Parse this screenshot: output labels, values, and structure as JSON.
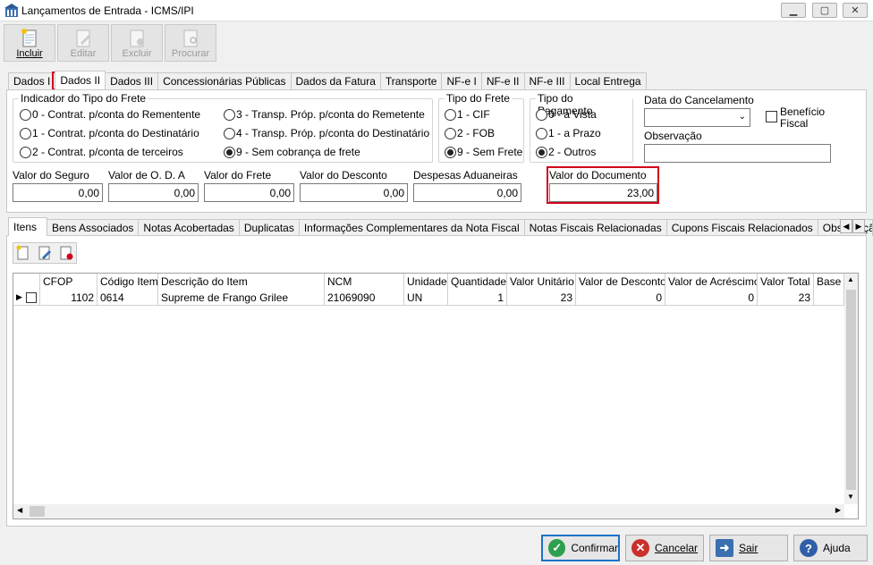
{
  "window": {
    "title": "Lançamentos de Entrada - ICMS/IPI"
  },
  "toolbar": {
    "incluir": "Incluir",
    "editar": "Editar",
    "excluir": "Excluir",
    "procurar": "Procurar"
  },
  "tabs": [
    "Dados I",
    "Dados II",
    "Dados III",
    "Concessionárias Públicas",
    "Dados da Fatura",
    "Transporte",
    "NF-e I",
    "NF-e II",
    "NF-e III",
    "Local Entrega"
  ],
  "frete": {
    "label": "Indicador do Tipo do Frete",
    "options": [
      "0 - Contrat. p/conta do Rementente",
      "1 - Contrat. p/conta do Destinatário",
      "2 - Contrat. p/conta de terceiros",
      "3 - Transp. Próp. p/conta do Remetente",
      "4 - Transp. Próp. p/conta do Destinatário",
      "9 - Sem cobrança de frete"
    ]
  },
  "tipo_frete": {
    "label": "Tipo do Frete",
    "options": [
      "1 - CIF",
      "2 - FOB",
      "9 - Sem Frete"
    ]
  },
  "tipo_pagamento": {
    "label": "Tipo do Pagamento",
    "options": [
      "0 - à Vista",
      "1 - a Prazo",
      "2 - Outros"
    ]
  },
  "cancel": {
    "label": "Data do Cancelamento",
    "value": ""
  },
  "beneficio": {
    "label1": "Benefício",
    "label2": "Fiscal"
  },
  "observacao": {
    "label": "Observação",
    "value": ""
  },
  "valores": {
    "seguro": {
      "label": "Valor do Seguro",
      "value": "0,00"
    },
    "oda": {
      "label": "Valor de O. D. A",
      "value": "0,00"
    },
    "frete": {
      "label": "Valor do Frete",
      "value": "0,00"
    },
    "desconto": {
      "label": "Valor do Desconto",
      "value": "0,00"
    },
    "aduaneiras": {
      "label": "Despesas Aduaneiras",
      "value": "0,00"
    },
    "documento": {
      "label": "Valor do Documento",
      "value": "23,00"
    }
  },
  "lower_tabs": [
    "Itens",
    "Bens Associados",
    "Notas Acobertadas",
    "Duplicatas",
    "Informações Complementares da Nota Fiscal",
    "Notas Fiscais Relacionadas",
    "Cupons Fiscais Relacionados",
    "Observaçã"
  ],
  "grid": {
    "headers": [
      "CFOP",
      "Código Item",
      "Descrição do Item",
      "NCM",
      "Unidade",
      "Quantidade",
      "Valor Unitário",
      "Valor de Desconto",
      "Valor de Acréscimo",
      "Valor Total",
      "Base d"
    ],
    "rows": [
      [
        "1102",
        "0614",
        "Supreme de Frango Grilee",
        "21069090",
        "UN",
        "1",
        "23",
        "0",
        "0",
        "23",
        ""
      ]
    ]
  },
  "buttons": {
    "confirmar": "Confirmar",
    "cancelar": "Cancelar",
    "sair": "Sair",
    "ajuda": "Ajuda"
  },
  "colors": {
    "highlight": "#d0021b",
    "accent": "#1a73c8"
  }
}
